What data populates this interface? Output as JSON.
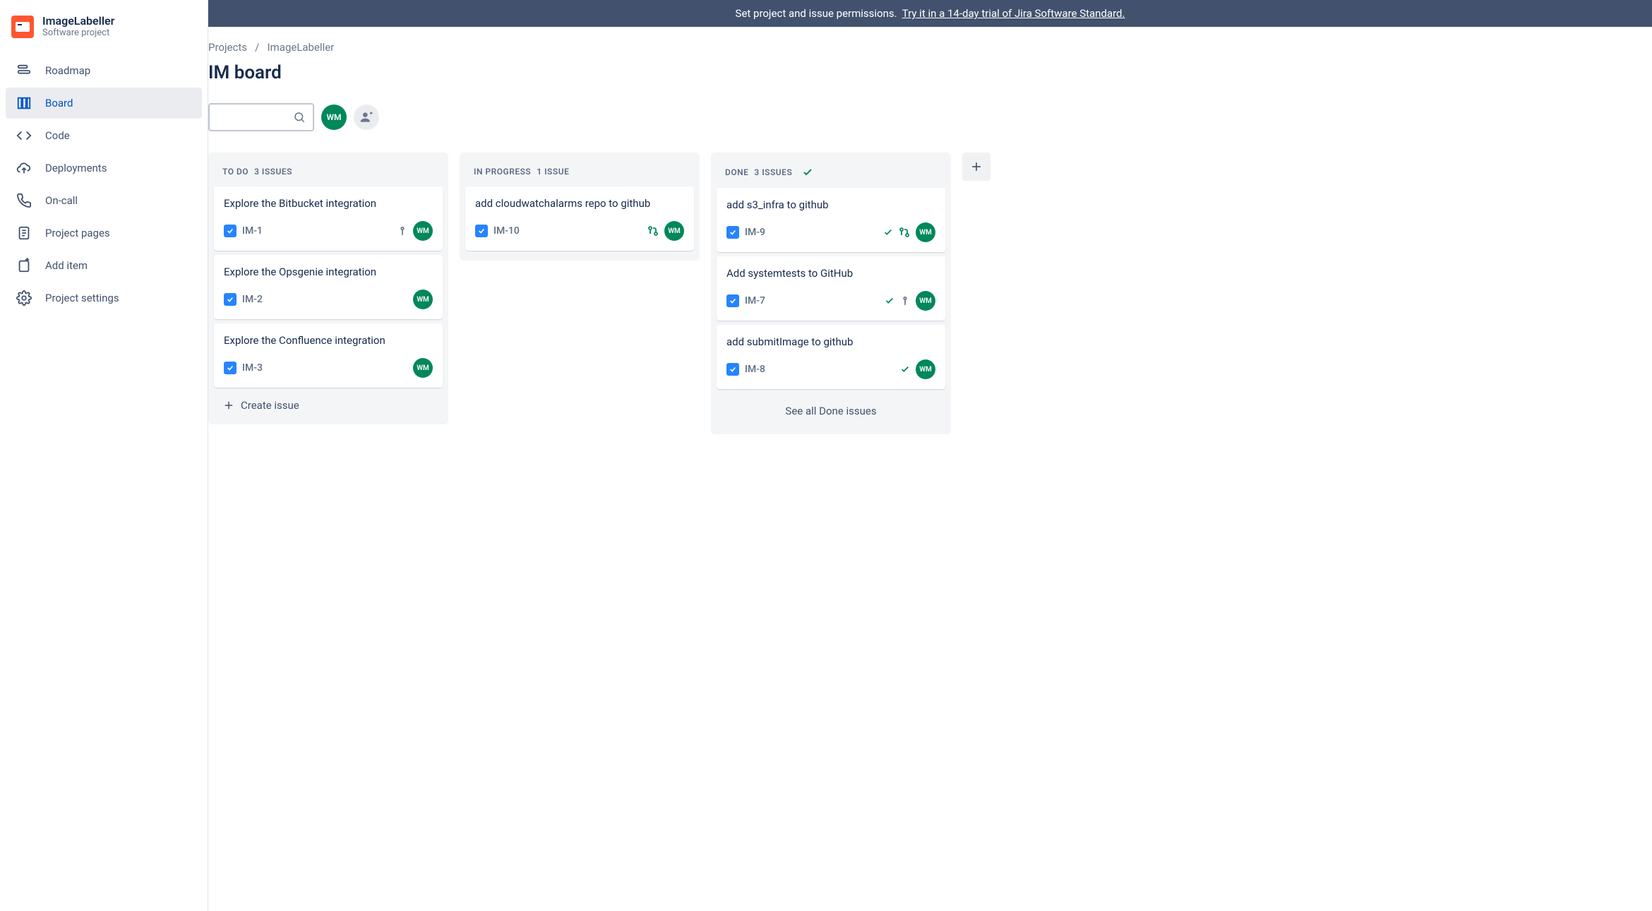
{
  "project": {
    "name": "ImageLabeller",
    "subtitle": "Software project"
  },
  "sidebar": {
    "items": [
      {
        "label": "Roadmap"
      },
      {
        "label": "Board"
      },
      {
        "label": "Code"
      },
      {
        "label": "Deployments"
      },
      {
        "label": "On-call"
      },
      {
        "label": "Project pages"
      },
      {
        "label": "Add item"
      },
      {
        "label": "Project settings"
      }
    ]
  },
  "banner": {
    "text": "Set project and issue permissions.",
    "link": "Try it in a 14-day trial of Jira Software Standard."
  },
  "breadcrumb": {
    "root": "Projects",
    "current": "ImageLabeller",
    "sep": "/"
  },
  "board": {
    "title": "IM board",
    "user_initials": "WM",
    "create_issue": "Create issue",
    "see_all_done": "See all Done issues",
    "columns": [
      {
        "name": "TO DO",
        "count": "3 ISSUES"
      },
      {
        "name": "IN PROGRESS",
        "count": "1 ISSUE"
      },
      {
        "name": "DONE",
        "count": "3 ISSUES"
      }
    ],
    "todo": [
      {
        "title": "Explore the Bitbucket integration",
        "key": "IM-1",
        "priority": true
      },
      {
        "title": "Explore the Opsgenie integration",
        "key": "IM-2"
      },
      {
        "title": "Explore the Confluence integration",
        "key": "IM-3"
      }
    ],
    "inprogress": [
      {
        "title": "add cloudwatchalarms repo to github",
        "key": "IM-10",
        "pr": true
      }
    ],
    "done": [
      {
        "title": "add s3_infra to github",
        "key": "IM-9",
        "check": true,
        "pr": true
      },
      {
        "title": "Add systemtests to GitHub",
        "key": "IM-7",
        "check": true,
        "priority": true
      },
      {
        "title": "add submitImage to github",
        "key": "IM-8",
        "check": true
      }
    ]
  }
}
